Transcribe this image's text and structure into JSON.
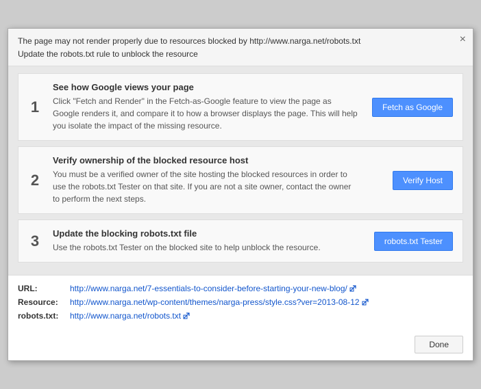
{
  "dialog": {
    "header": {
      "title": "The page may not render properly due to resources blocked by http://www.narga.net/robots.txt",
      "subtitle": "Update the robots.txt rule to unblock the resource",
      "close_label": "×"
    },
    "steps": [
      {
        "number": "1",
        "title": "See how Google views your page",
        "desc": "Click \"Fetch and Render\" in the Fetch-as-Google feature to view the page as Google renders it, and compare it to how a browser displays the page. This will help you isolate the impact of the missing resource.",
        "button_label": "Fetch as Google"
      },
      {
        "number": "2",
        "title": "Verify ownership of the blocked resource host",
        "desc": "You must be a verified owner of the site hosting the blocked resources in order to use the robots.txt Tester on that site. If you are not a site owner, contact the owner to perform the next steps.",
        "button_label": "Verify Host"
      },
      {
        "number": "3",
        "title": "Update the blocking robots.txt file",
        "desc": "Use the robots.txt Tester on the blocked site to help unblock the resource.",
        "button_label": "robots.txt Tester"
      }
    ],
    "footer": {
      "url_label": "URL:",
      "url_link": "http://www.narga.net/7-essentials-to-consider-before-starting-your-new-blog/",
      "resource_label": "Resource:",
      "resource_link": "http://www.narga.net/wp-content/themes/narga-press/style.css?ver=2013-08-12",
      "robots_label": "robots.txt:",
      "robots_link": "http://www.narga.net/robots.txt"
    },
    "done_label": "Done"
  }
}
